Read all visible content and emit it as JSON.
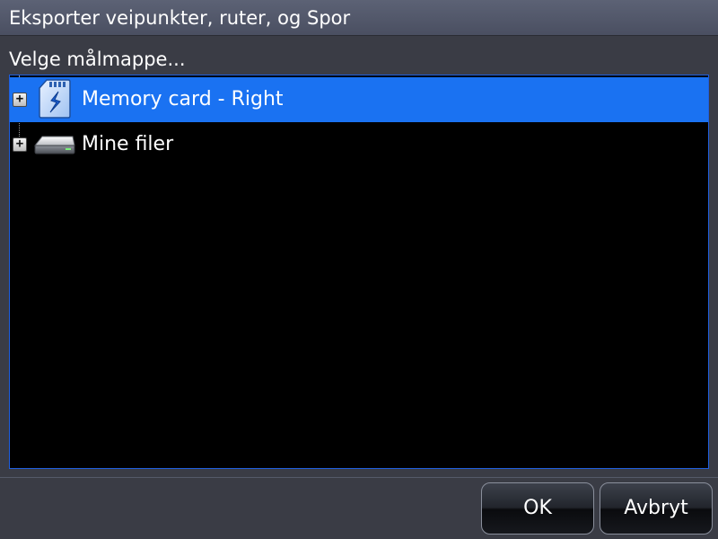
{
  "window": {
    "title": "Eksporter veipunkter, ruter, og Spor"
  },
  "dialog": {
    "prompt": "Velge målmappe..."
  },
  "tree": {
    "items": [
      {
        "label": "Memory card - Right",
        "icon": "sd-card-icon",
        "expander": "+",
        "selected": true
      },
      {
        "label": "Mine filer",
        "icon": "hard-drive-icon",
        "expander": "+",
        "selected": false
      }
    ]
  },
  "buttons": {
    "ok_label": "OK",
    "cancel_label": "Avbryt"
  },
  "colors": {
    "selection": "#1a72f2",
    "tree_border": "#1f5fe0",
    "background": "#3a3c45"
  }
}
